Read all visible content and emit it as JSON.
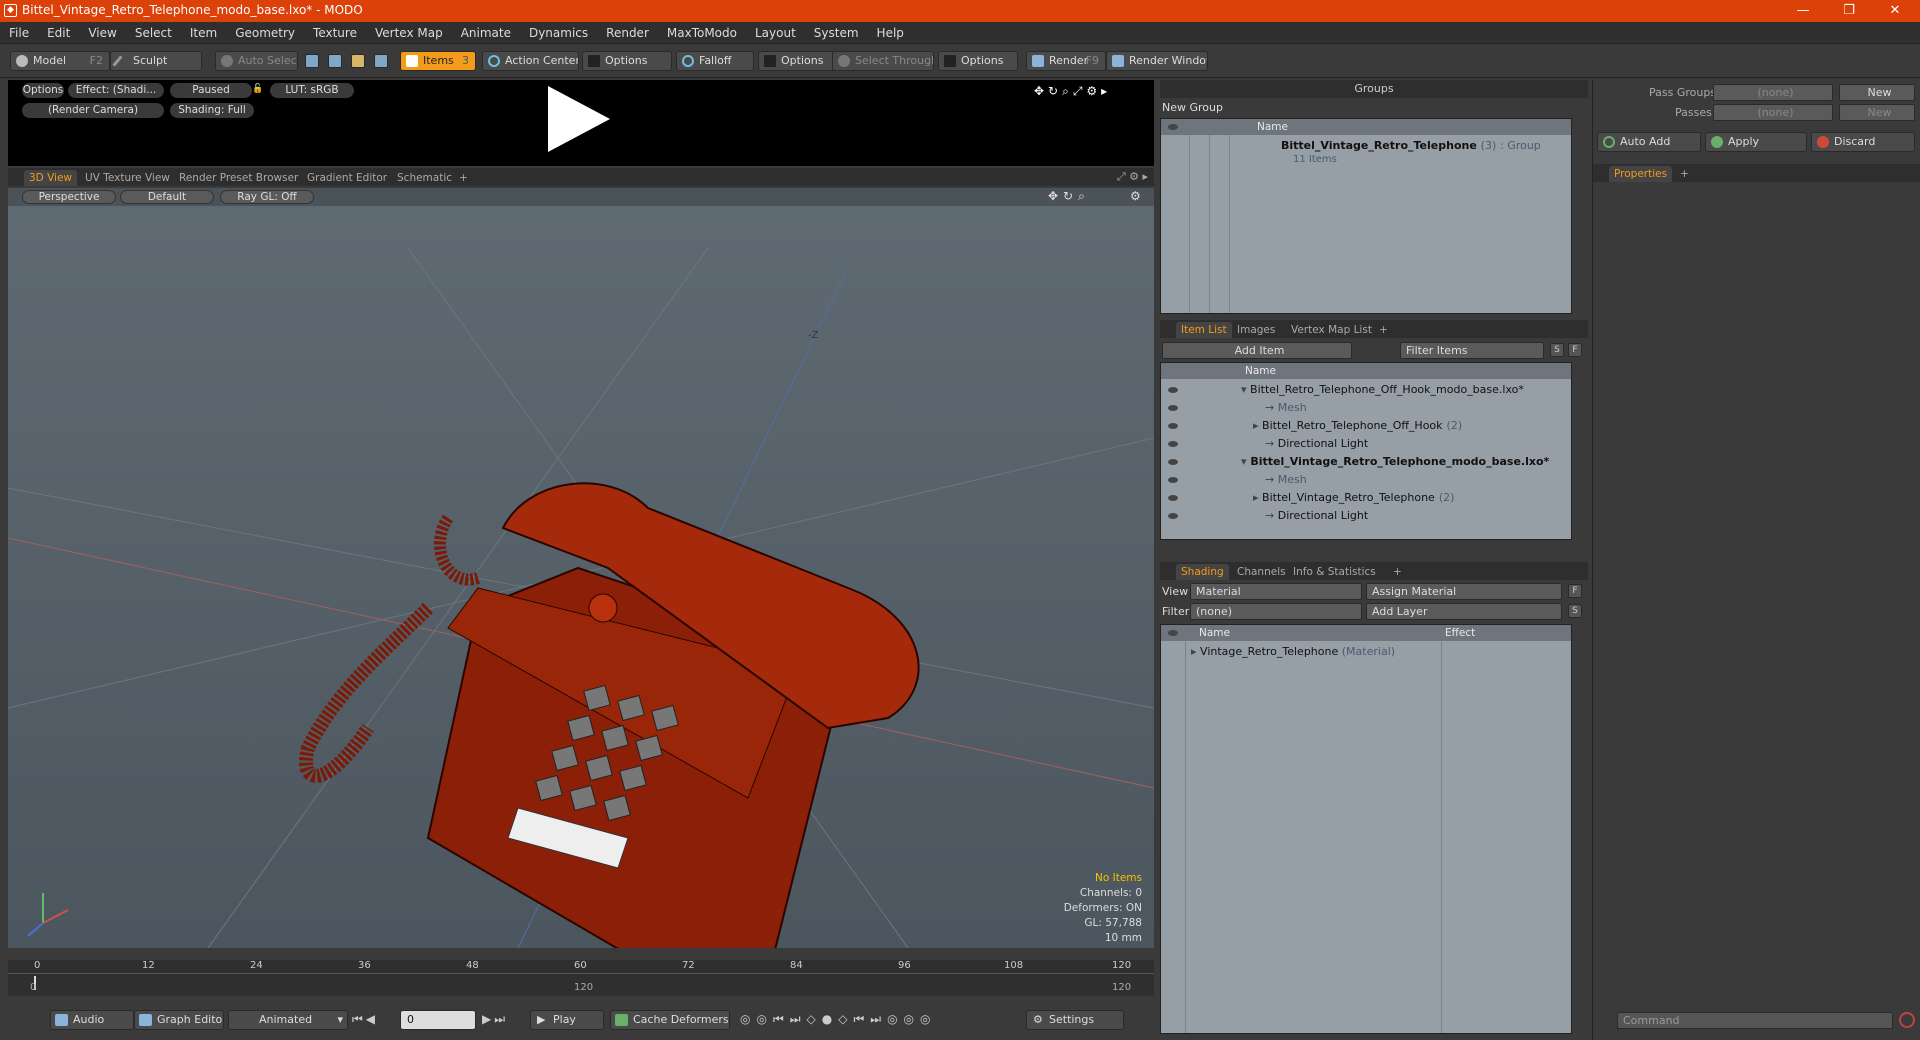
{
  "window": {
    "title": "Bittel_Vintage_Retro_Telephone_modo_base.lxo* - MODO",
    "minimize": "—",
    "maximize": "❐",
    "close": "✕"
  },
  "menu": [
    "File",
    "Edit",
    "View",
    "Select",
    "Item",
    "Geometry",
    "Texture",
    "Vertex Map",
    "Animate",
    "Dynamics",
    "Render",
    "MaxToModo",
    "Layout",
    "System",
    "Help"
  ],
  "toolbar": {
    "model": "Model",
    "model_key": "F2",
    "sculpt": "Sculpt",
    "auto_select": "Auto Select",
    "items": "Items",
    "items_key": "3",
    "action_center": "Action Center",
    "options1": "Options",
    "falloff": "Falloff",
    "options2": "Options",
    "select_through": "Select Through",
    "options3": "Options",
    "render": "Render",
    "render_key": "F9",
    "render_window": "Render Window"
  },
  "preview": {
    "options": "Options",
    "effect": "Effect: (Shadi...",
    "paused": "Paused",
    "lut": "LUT: sRGB",
    "camera": "(Render Camera)",
    "shading": "Shading: Full"
  },
  "view_tabs": [
    "3D View",
    "UV Texture View",
    "Render Preset Browser",
    "Gradient Editor",
    "Schematic",
    "+"
  ],
  "viewport": {
    "perspective": "Perspective",
    "default": "Default",
    "raygl": "Ray GL: Off",
    "axis_label": "-Z",
    "stats": {
      "no_items": "No Items",
      "channels": "Channels: 0",
      "deformers": "Deformers: ON",
      "gl": "GL: 57,788",
      "unit": "10 mm"
    }
  },
  "timeline": {
    "ticks": [
      "0",
      "12",
      "24",
      "36",
      "48",
      "60",
      "72",
      "84",
      "96",
      "108",
      "120"
    ],
    "sub_ticks": [
      "0",
      "120",
      "120"
    ]
  },
  "bottom": {
    "audio": "Audio",
    "graph_editor": "Graph Editor",
    "animated": "Animated",
    "frame": "0",
    "play": "Play",
    "cache": "Cache Deformers",
    "settings": "Settings"
  },
  "groups": {
    "title": "Groups",
    "new_group": "New Group",
    "col_name": "Name",
    "row_name": "Bittel_Vintage_Retro_Telephone",
    "row_count": "(3)",
    "row_type": ": Group",
    "row_items": "11 Items"
  },
  "passes": {
    "pass_groups": "Pass Groups",
    "passes": "Passes",
    "none1": "(none)",
    "none2": "(none)",
    "new1": "New",
    "new2": "New",
    "auto_add": "Auto Add",
    "apply": "Apply",
    "discard": "Discard",
    "properties": "Properties",
    "command": "Command"
  },
  "itemlist": {
    "tabs": [
      "Item List",
      "Images",
      "Vertex Map List",
      "+"
    ],
    "add_item": "Add Item",
    "filter": "Filter Items",
    "s": "S",
    "f": "F",
    "col_name": "Name",
    "rows": [
      {
        "label": "Bittel_Retro_Telephone_Off_Hook_modo_base.lxo*",
        "count": "",
        "dim": false,
        "bold": false,
        "indent": 0
      },
      {
        "label": "Mesh",
        "count": "",
        "dim": true,
        "bold": false,
        "indent": 2
      },
      {
        "label": "Bittel_Retro_Telephone_Off_Hook",
        "count": "(2)",
        "dim": false,
        "bold": false,
        "indent": 1
      },
      {
        "label": "Directional Light",
        "count": "",
        "dim": false,
        "bold": false,
        "indent": 2
      },
      {
        "label": "Bittel_Vintage_Retro_Telephone_modo_base.lxo*",
        "count": "",
        "dim": false,
        "bold": true,
        "indent": 0
      },
      {
        "label": "Mesh",
        "count": "",
        "dim": true,
        "bold": false,
        "indent": 2
      },
      {
        "label": "Bittel_Vintage_Retro_Telephone",
        "count": "(2)",
        "dim": false,
        "bold": false,
        "indent": 1
      },
      {
        "label": "Directional Light",
        "count": "",
        "dim": false,
        "bold": false,
        "indent": 2
      }
    ]
  },
  "shading": {
    "tabs": [
      "Shading",
      "Channels",
      "Info & Statistics",
      "+"
    ],
    "view_label": "View",
    "view_value": "Material",
    "assign": "Assign Material",
    "filter_label": "Filter",
    "filter_value": "(none)",
    "add_layer": "Add Layer",
    "f": "F",
    "s": "S",
    "col_name": "Name",
    "col_effect": "Effect",
    "row_name": "Vintage_Retro_Telephone",
    "row_type": "(Material)"
  }
}
